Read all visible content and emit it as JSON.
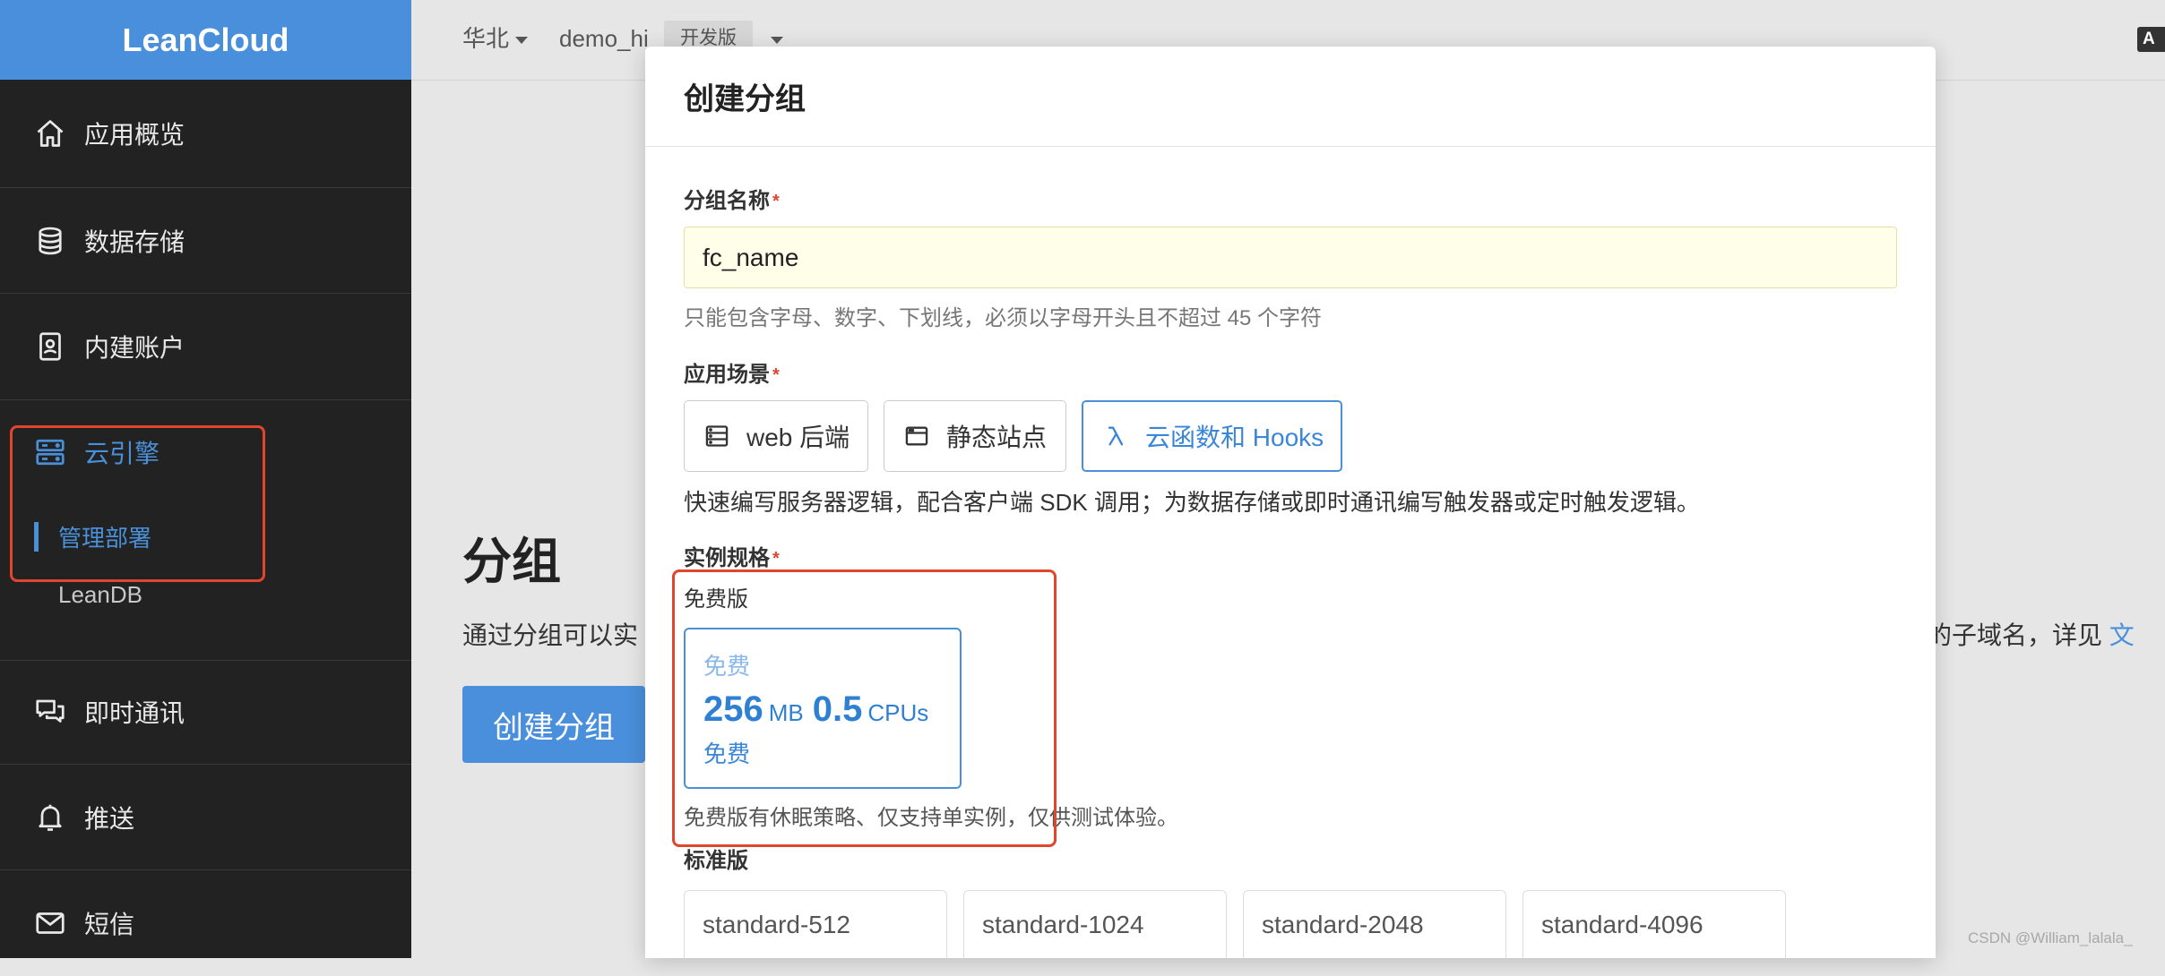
{
  "sidebar": {
    "logo": "LeanCloud",
    "items": [
      {
        "label": "应用概览",
        "icon": "home-icon"
      },
      {
        "label": "数据存储",
        "icon": "database-icon"
      },
      {
        "label": "内建账户",
        "icon": "contact-card-icon"
      },
      {
        "label": "云引擎",
        "icon": "server-icon",
        "active": true,
        "children": [
          {
            "label": "管理部署",
            "active": true
          },
          {
            "label": "LeanDB"
          }
        ]
      },
      {
        "label": "即时通讯",
        "icon": "chat-icon"
      },
      {
        "label": "推送",
        "icon": "bell-icon"
      },
      {
        "label": "短信",
        "icon": "mail-icon"
      }
    ]
  },
  "header": {
    "region": "华北",
    "app_name": "demo_hi",
    "plan_badge": "开发版",
    "right_badge": "A"
  },
  "page": {
    "title": "分组",
    "desc_left": "通过分组可以实",
    "desc_right": "的子域名，详见 ",
    "desc_link": "文",
    "create_button": "创建分组"
  },
  "modal": {
    "title": "创建分组",
    "name_field": {
      "label": "分组名称",
      "required_mark": "*",
      "value": "fc_name",
      "help": "只能包含字母、数字、下划线，必须以字母开头且不超过 45 个字符"
    },
    "scenario": {
      "label": "应用场景",
      "required_mark": "*",
      "options": [
        {
          "label": "web 后端",
          "icon": "server-rack-icon"
        },
        {
          "label": "静态站点",
          "icon": "browser-window-icon"
        },
        {
          "label": "云函数和 Hooks",
          "icon": "lambda-icon",
          "selected": true
        }
      ],
      "description": "快速编写服务器逻辑，配合客户端 SDK 调用；为数据存储或即时通讯编写触发器或定时触发逻辑。"
    },
    "spec": {
      "label": "实例规格",
      "required_mark": "*",
      "free_tier": {
        "heading": "免费版",
        "card": {
          "name": "免费",
          "memory": "256",
          "memory_unit": "MB",
          "cpu": "0.5",
          "cpu_unit": "CPUs",
          "price": "免费",
          "selected": true
        },
        "note": "免费版有休眠策略、仅支持单实例，仅供测试体验。"
      },
      "standard_tier": {
        "heading": "标准版",
        "cards": [
          "standard-512",
          "standard-1024",
          "standard-2048",
          "standard-4096"
        ]
      }
    }
  },
  "colors": {
    "accent": "#4a90d9",
    "highlight": "#e0452e",
    "sidebar_bg": "#222222",
    "logo_bg": "#4a8fdb"
  },
  "watermark": "CSDN @William_lalala_"
}
